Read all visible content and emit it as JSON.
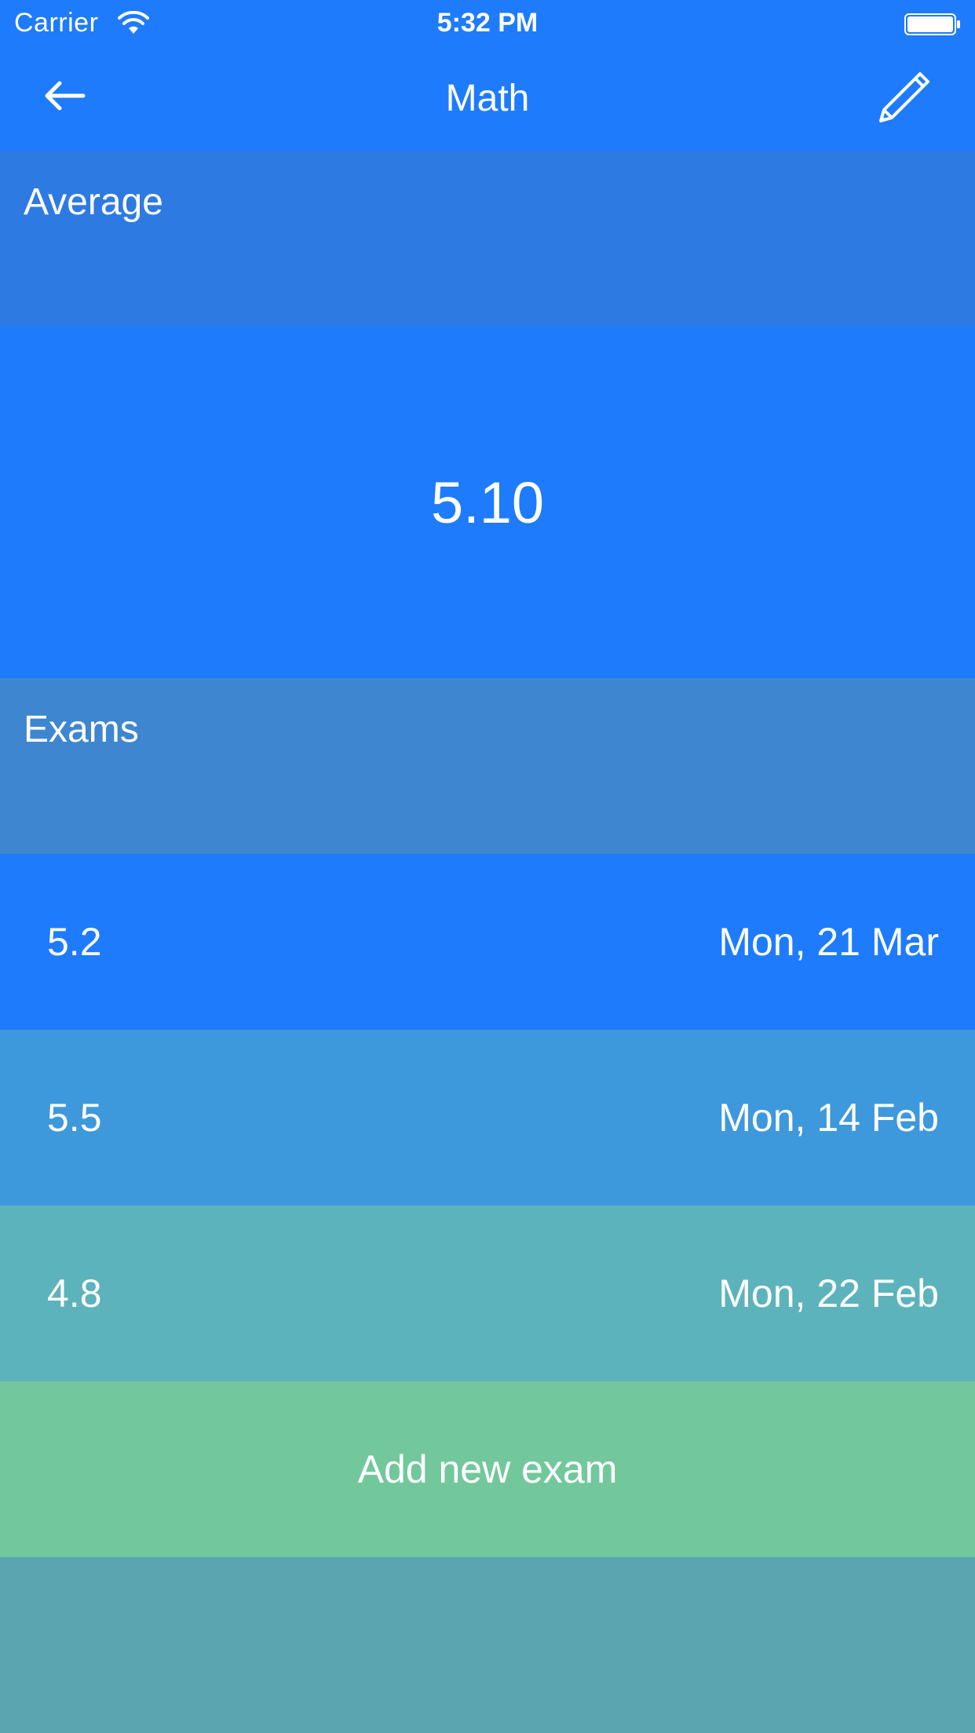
{
  "status_bar": {
    "carrier": "Carrier",
    "time": "5:32 PM",
    "wifi_icon": "wifi-icon",
    "battery_icon": "battery-icon"
  },
  "nav": {
    "title": "Math",
    "back_icon": "arrow-left-icon",
    "edit_icon": "pencil-icon"
  },
  "average": {
    "header": "Average",
    "value": "5.10"
  },
  "exams": {
    "header": "Exams",
    "items": [
      {
        "grade": "5.2",
        "date": "Mon, 21 Mar"
      },
      {
        "grade": "5.5",
        "date": "Mon, 14 Feb"
      },
      {
        "grade": "4.8",
        "date": "Mon, 22 Feb"
      }
    ],
    "add_label": "Add new exam"
  },
  "colors": {
    "primary_blue": "#1e7bfc",
    "average_header": "#2e7ae3",
    "exams_header": "#3e87d0",
    "row_2": "#3e98dc",
    "row_3": "#5db3bb",
    "add_button": "#72c89c",
    "footer": "#5ba5b1"
  }
}
